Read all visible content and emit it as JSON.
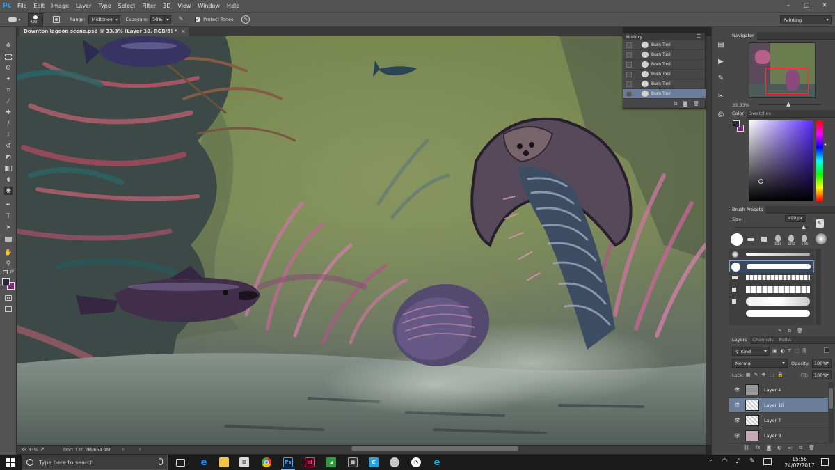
{
  "app": {
    "logo": "Ps",
    "workspace": "Painting"
  },
  "menu": [
    "File",
    "Edit",
    "Image",
    "Layer",
    "Type",
    "Select",
    "Filter",
    "3D",
    "View",
    "Window",
    "Help"
  ],
  "window_controls": [
    "–",
    "□",
    "✕"
  ],
  "options": {
    "brush_size": "499",
    "range_label": "Range:",
    "range_value": "Midtones",
    "exposure_label": "Exposure:",
    "exposure_value": "50%",
    "protect_tones_label": "Protect Tones",
    "protect_tones_checked": true
  },
  "document": {
    "tab_title": "Downton lagoon scene.psd @ 33.3% (Layer 10, RGB/8) *"
  },
  "status": {
    "zoom": "33.33%",
    "doc": "Doc: 120.2M/664.9M"
  },
  "history": {
    "title": "History",
    "items": [
      "Burn Tool",
      "Burn Tool",
      "Burn Tool",
      "Burn Tool",
      "Burn Tool",
      "Burn Tool"
    ],
    "selected_index": 5
  },
  "navigator": {
    "title": "Navigator",
    "zoom": "33.33%"
  },
  "color_panel": {
    "tabs": [
      "Color",
      "Swatches"
    ],
    "foreground": "#2a2540",
    "background": "#7a2a7a"
  },
  "brush_presets": {
    "title": "Brush Presets",
    "size_label": "Size:",
    "size_value": "499 px",
    "preset_sizes": [
      "111",
      "102",
      "186"
    ]
  },
  "layers_panel": {
    "tabs": [
      "Layers",
      "Channels",
      "Paths"
    ],
    "kind": "Kind",
    "blend_mode": "Normal",
    "opacity_label": "Opacity:",
    "opacity_value": "100%",
    "lock_label": "Lock:",
    "fill_label": "Fill:",
    "fill_value": "100%",
    "layers": [
      {
        "name": "Layer 4",
        "selected": false
      },
      {
        "name": "Layer 10",
        "selected": true
      },
      {
        "name": "Layer 7",
        "selected": false
      },
      {
        "name": "Layer 3",
        "selected": false
      }
    ]
  },
  "taskbar": {
    "search_placeholder": "Type here to search",
    "time": "15:56",
    "date": "24/07/2017",
    "apps": [
      "task-view",
      "edge",
      "file-explorer",
      "store",
      "chrome",
      "photoshop",
      "indesign",
      "greenshot",
      "calculator",
      "camtasia",
      "fox",
      "uplay",
      "ie"
    ]
  }
}
